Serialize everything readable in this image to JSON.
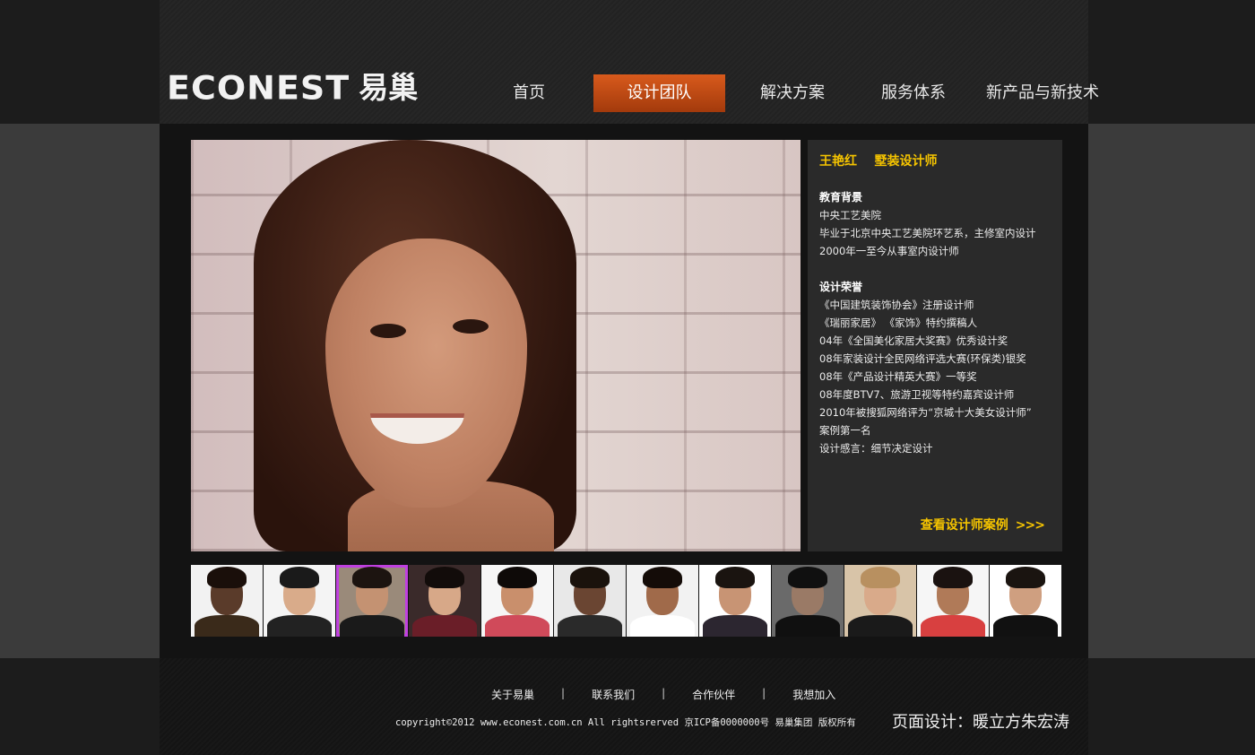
{
  "logo": {
    "word": "ECONEST",
    "cn": "易巢"
  },
  "nav": {
    "items": [
      {
        "label": "首页",
        "active": false
      },
      {
        "label": "设计团队",
        "active": true
      },
      {
        "label": "解决方案",
        "active": false
      },
      {
        "label": "服务体系",
        "active": false
      },
      {
        "label": "新产品与新技术",
        "active": false
      }
    ]
  },
  "designer": {
    "title": "王艳红    墅装设计师",
    "education_head": "教育背景",
    "education": [
      "中央工艺美院",
      "毕业于北京中央工艺美院环艺系，主修室内设计",
      "2000年一至今从事室内设计师"
    ],
    "honors_head": "设计荣誉",
    "honors": [
      "《中国建筑装饰协会》注册设计师",
      "《瑞丽家居》 《家饰》特约撰稿人",
      "04年《全国美化家居大奖赛》优秀设计奖",
      "08年家装设计全民网络评选大赛(环保类)银奖",
      "08年《产品设计精英大赛》一等奖",
      "08年度BTV7、旅游卫视等特约嘉宾设计师",
      "2010年被搜狐网络评为“京城十大美女设计师”",
      "案例第一名",
      "设计感言：细节决定设计"
    ],
    "cases_link": "查看设计师案例",
    "cases_arrows": ">>>"
  },
  "thumbnails": [
    {
      "skin": "#5a3b2a",
      "hair": "#1a0f0a",
      "shirt": "#3a2a1a",
      "bg": "#f2f2f2",
      "selected": false
    },
    {
      "skin": "#d9ab8a",
      "hair": "#1a1a1a",
      "shirt": "#222222",
      "bg": "#f4f4f4",
      "selected": false
    },
    {
      "skin": "#c49272",
      "hair": "#1c1410",
      "shirt": "#1a1a1a",
      "bg": "#9a8a7a",
      "selected": true
    },
    {
      "skin": "#d7a888",
      "hair": "#120c0a",
      "shirt": "#6a1e28",
      "bg": "#3a2a2a",
      "selected": false
    },
    {
      "skin": "#c98f6c",
      "hair": "#0e0a08",
      "shirt": "#d04a5a",
      "bg": "#f6f6f6",
      "selected": false
    },
    {
      "skin": "#6a4532",
      "hair": "#1a120c",
      "shirt": "#2a2a2a",
      "bg": "#e8e8e8",
      "selected": false
    },
    {
      "skin": "#a06a4a",
      "hair": "#140c08",
      "shirt": "#ffffff",
      "bg": "#f2f2f2",
      "selected": false
    },
    {
      "skin": "#c89474",
      "hair": "#1a1410",
      "shirt": "#2c2630",
      "bg": "#ffffff",
      "selected": false
    },
    {
      "skin": "#9a7a66",
      "hair": "#101010",
      "shirt": "#101010",
      "bg": "#6a6a6a",
      "selected": false
    },
    {
      "skin": "#d9aa8a",
      "hair": "#b89060",
      "shirt": "#1a1a1a",
      "bg": "#d8c4a8",
      "selected": false
    },
    {
      "skin": "#b07a58",
      "hair": "#1a1210",
      "shirt": "#d84040",
      "bg": "#f6f6f6",
      "selected": false
    },
    {
      "skin": "#cf9f80",
      "hair": "#1a1410",
      "shirt": "#111111",
      "bg": "#ffffff",
      "selected": false
    }
  ],
  "footer": {
    "links": [
      "关于易巢",
      "联系我们",
      "合作伙伴",
      "我想加入"
    ],
    "separator": "|",
    "copyright": "copyright©2012 www.econest.com.cn All rightsrerved 京ICP备0000000号 易巢集团 版权所有",
    "credit": "页面设计：暖立方朱宏涛"
  },
  "colors": {
    "accent_orange": "#c94a14",
    "accent_yellow": "#f5c400",
    "selected_border": "#c040e0"
  }
}
